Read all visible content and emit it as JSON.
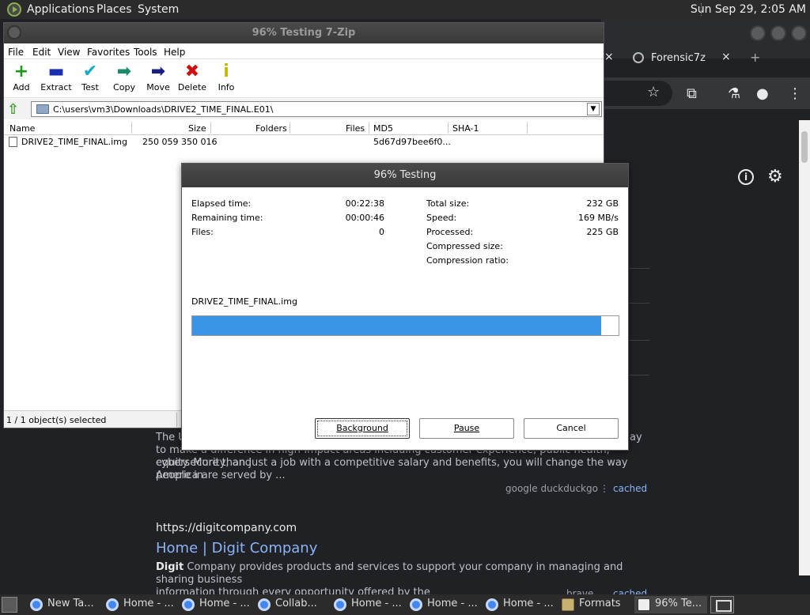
{
  "top_panel": {
    "applications": "Applications",
    "places": "Places",
    "system": "System",
    "clock": "Sun Sep 29,  2:05 AM"
  },
  "browser": {
    "tab_title": "Forensic7z",
    "tab_close": "×",
    "new_tab": "+",
    "results": {
      "snippet1_line1": "The U",
      "snippet1_line1_end": "ay",
      "snippet1_line2": "to make a difference in high-impact areas including customer experience, public health, cybersecurity, and",
      "snippet1_line3": "equity. More than just a job with a competitive salary and benefits, you will change the way people in",
      "snippet1_line4": "America are served by ...",
      "sources1": "google  duckduckgo",
      "cached": "cached",
      "result2_url": "https://digitcompany.com",
      "result2_title": "Home | Digit Company",
      "result2_bold": "Digit",
      "result2_desc": " Company provides products and services to support your company in managing and sharing business",
      "result2_desc2": "information through every opportunity offered by the",
      "sources2": "brave",
      "cached2": "cached"
    }
  },
  "zip": {
    "title": "96% Testing 7-Zip",
    "menu": [
      "File",
      "Edit",
      "View",
      "Favorites",
      "Tools",
      "Help"
    ],
    "toolbar": [
      {
        "label": "Add",
        "icon": "plus-icon",
        "glyph": "+",
        "color": "#1a9a1a"
      },
      {
        "label": "Extract",
        "icon": "minus-icon",
        "glyph": "▬",
        "color": "#1a2fb0"
      },
      {
        "label": "Test",
        "icon": "check-icon",
        "glyph": "✔",
        "color": "#1aa8c8"
      },
      {
        "label": "Copy",
        "icon": "copy-arrow-icon",
        "glyph": "➡",
        "color": "#1a8a6a"
      },
      {
        "label": "Move",
        "icon": "move-arrow-icon",
        "glyph": "➡",
        "color": "#1a2080"
      },
      {
        "label": "Delete",
        "icon": "delete-x-icon",
        "glyph": "✖",
        "color": "#d01010"
      },
      {
        "label": "Info",
        "icon": "info-icon",
        "glyph": "i",
        "color": "#c8b800"
      }
    ],
    "address": "C:\\users\\vm3\\Downloads\\DRIVE2_TIME_FINAL.E01\\",
    "columns": [
      "Name",
      "Size",
      "Folders",
      "Files",
      "MD5",
      "SHA-1"
    ],
    "rows": [
      {
        "name": "DRIVE2_TIME_FINAL.img",
        "size": "250 059 350 016",
        "md5": "5d67d97bee6f0..."
      }
    ],
    "status": "1 / 1 object(s) selected"
  },
  "dialog": {
    "title": "96% Testing",
    "elapsed_label": "Elapsed time:",
    "elapsed_value": "00:22:38",
    "remaining_label": "Remaining time:",
    "remaining_value": "00:00:46",
    "files_label": "Files:",
    "files_value": "0",
    "total_label": "Total size:",
    "total_value": "232 GB",
    "speed_label": "Speed:",
    "speed_value": "169 MB/s",
    "processed_label": "Processed:",
    "processed_value": "225 GB",
    "compressed_label": "Compressed size:",
    "ratio_label": "Compression ratio:",
    "current_file": "DRIVE2_TIME_FINAL.img",
    "progress_percent": 96,
    "progress_color": "#3a94e8",
    "background_btn": "Background",
    "pause_btn": "Pause",
    "cancel_btn": "Cancel"
  },
  "taskbar": {
    "items": [
      {
        "label": "New Ta...",
        "icon": "chrome-icon"
      },
      {
        "label": "Home - ...",
        "icon": "chrome-icon"
      },
      {
        "label": "Home - ...",
        "icon": "chrome-icon"
      },
      {
        "label": "Collab...",
        "icon": "chrome-icon"
      },
      {
        "label": "Home - ...",
        "icon": "chrome-icon"
      },
      {
        "label": "Home - ...",
        "icon": "chrome-icon"
      },
      {
        "label": "Home - ...",
        "icon": "chrome-icon"
      },
      {
        "label": "Formats",
        "icon": "folder-icon"
      },
      {
        "label": "96% Te...",
        "icon": "7zip-icon"
      }
    ]
  }
}
